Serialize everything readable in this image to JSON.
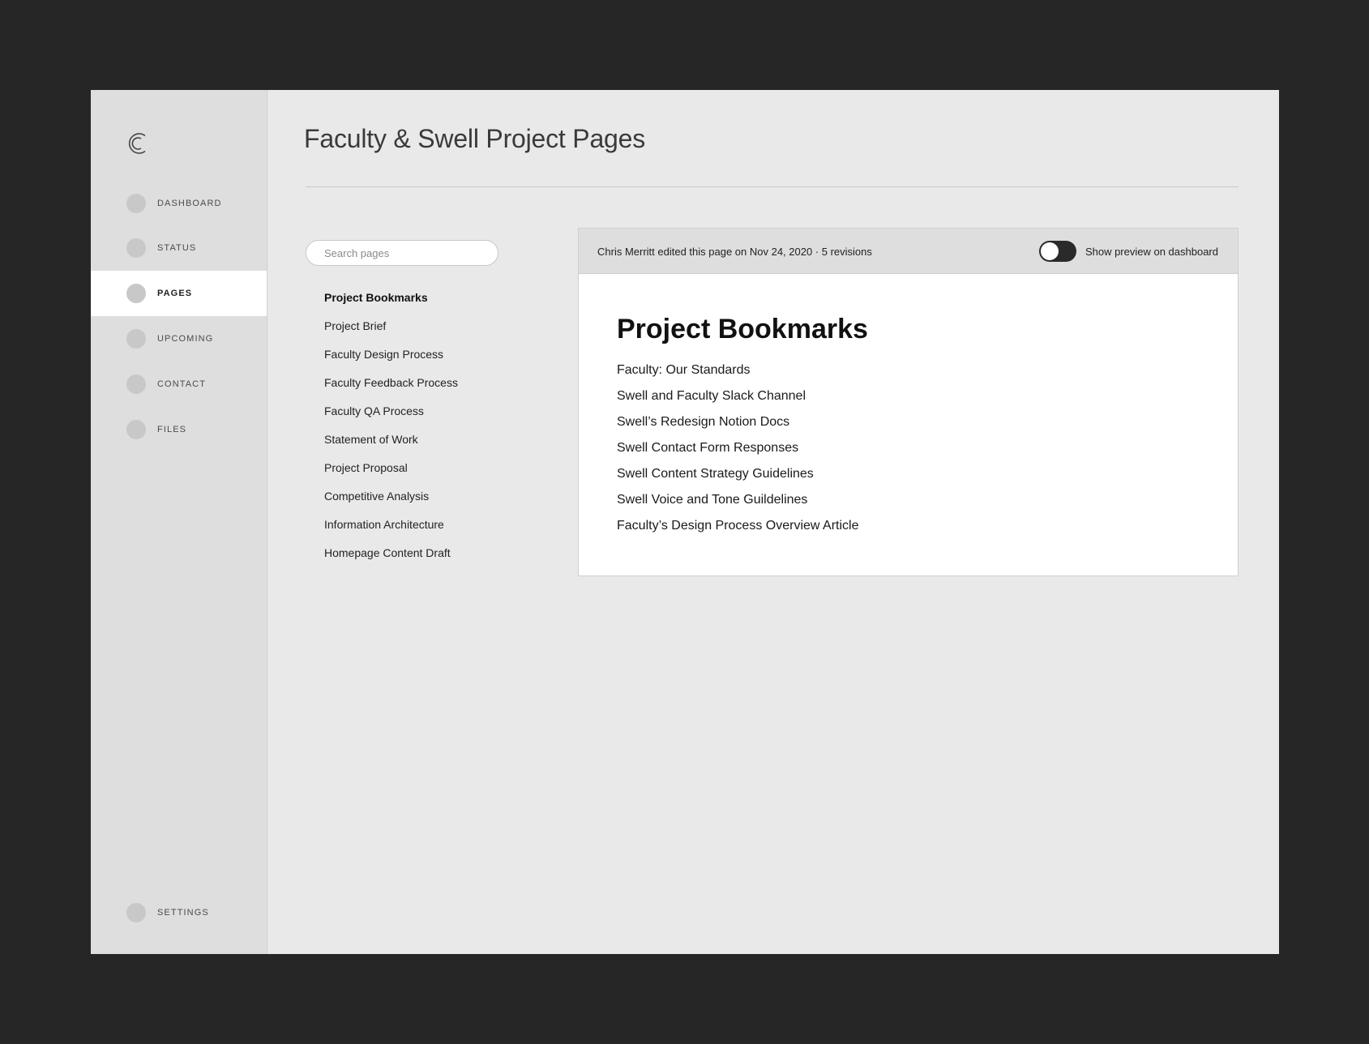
{
  "sidebar": {
    "logo_icon": "C-logo-icon",
    "nav_items": [
      {
        "label": "DASHBOARD",
        "active": false
      },
      {
        "label": "STATUS",
        "active": false
      },
      {
        "label": "PAGES",
        "active": true
      },
      {
        "label": "UPCOMING",
        "active": false
      },
      {
        "label": "CONTACT",
        "active": false
      },
      {
        "label": "FILES",
        "active": false
      }
    ],
    "settings_label": "SETTINGS"
  },
  "main": {
    "title": "Faculty & Swell Project Pages",
    "search": {
      "placeholder": "Search pages",
      "value": ""
    },
    "pages": [
      "Project Bookmarks",
      "Project Brief",
      "Faculty Design Process",
      "Faculty Feedback Process",
      "Faculty QA Process",
      "Statement of Work",
      "Project Proposal",
      "Competitive Analysis",
      "Information Architecture",
      "Homepage Content Draft"
    ],
    "selected_page_index": 0
  },
  "panel": {
    "edit_info": "Chris Merritt edited this page on Nov 24, 2020 · 5 revisions",
    "toggle_label": "Show preview on dashboard",
    "toggle_on": false,
    "doc_title": "Project Bookmarks",
    "bookmarks": [
      "Faculty: Our Standards",
      "Swell and Faculty Slack Channel",
      "Swell’s Redesign Notion Docs",
      "Swell Contact Form Responses",
      "Swell Content Strategy Guidelines",
      "Swell Voice and Tone Guildelines",
      "Faculty’s Design Process Overview Article"
    ]
  },
  "colors": {
    "backdrop": "#262626",
    "app_background": "#e9e9e9",
    "sidebar_background": "#dedede",
    "active_nav_background": "#ffffff",
    "toggle_track": "#2a2a2a"
  }
}
